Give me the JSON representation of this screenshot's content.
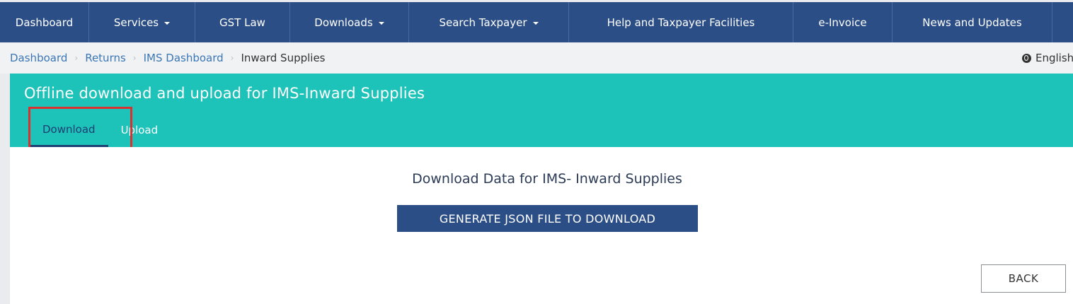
{
  "nav": {
    "items": [
      {
        "label": "Dashboard",
        "dropdown": false
      },
      {
        "label": "Services",
        "dropdown": true
      },
      {
        "label": "GST Law",
        "dropdown": false
      },
      {
        "label": "Downloads",
        "dropdown": true
      },
      {
        "label": "Search Taxpayer",
        "dropdown": true
      },
      {
        "label": "Help and Taxpayer Facilities",
        "dropdown": false
      },
      {
        "label": "e-Invoice",
        "dropdown": false
      },
      {
        "label": "News and Updates",
        "dropdown": false
      }
    ]
  },
  "breadcrumb": {
    "items": [
      "Dashboard",
      "Returns",
      "IMS Dashboard",
      "Inward Supplies"
    ]
  },
  "language": {
    "label": "English",
    "icon": "globe-icon"
  },
  "header": {
    "title": "Offline download and upload for IMS-Inward Supplies",
    "tabs": [
      {
        "label": "Download",
        "active": true
      },
      {
        "label": "Upload",
        "active": false
      }
    ]
  },
  "main": {
    "heading": "Download Data for IMS- Inward Supplies",
    "generate_button": "GENERATE JSON FILE TO DOWNLOAD",
    "back_button": "BACK"
  },
  "colors": {
    "nav_bg": "#2c4e86",
    "header_bg": "#1dc2b8",
    "highlight": "#d93030",
    "link": "#3b77b5"
  }
}
